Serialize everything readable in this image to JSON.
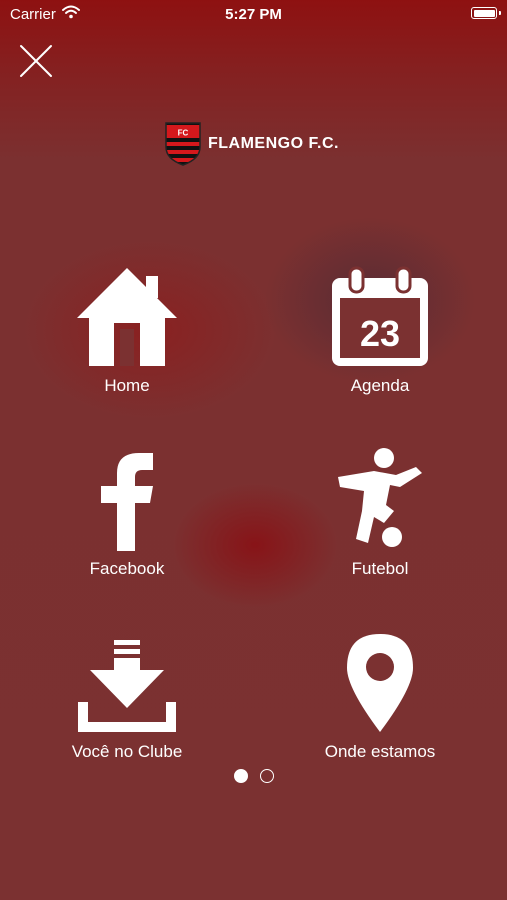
{
  "status_bar": {
    "carrier": "Carrier",
    "time": "5:27 PM",
    "icons": [
      "wifi-icon",
      "battery-icon"
    ]
  },
  "header": {
    "close_icon": "close-icon",
    "brand_name": "FLAMENGO F.C.",
    "crest_text": "FC",
    "logo_icon": "club-crest-logo"
  },
  "menu": {
    "items": [
      {
        "label": "Home",
        "icon": "home-icon"
      },
      {
        "label": "Agenda",
        "icon": "calendar-icon",
        "icon_text": "23"
      },
      {
        "label": "Facebook",
        "icon": "facebook-icon"
      },
      {
        "label": "Futebol",
        "icon": "soccer-player-icon"
      },
      {
        "label": "Você no Clube",
        "icon": "download-icon"
      },
      {
        "label": "Onde estamos",
        "icon": "location-pin-icon"
      }
    ]
  },
  "pager": {
    "pages": 2,
    "active_page": 1
  },
  "colors": {
    "background": "#7b3131",
    "top_tint": "#8e1111",
    "foreground": "#ffffff",
    "crest_red": "#d4181c",
    "crest_black": "#111111"
  }
}
